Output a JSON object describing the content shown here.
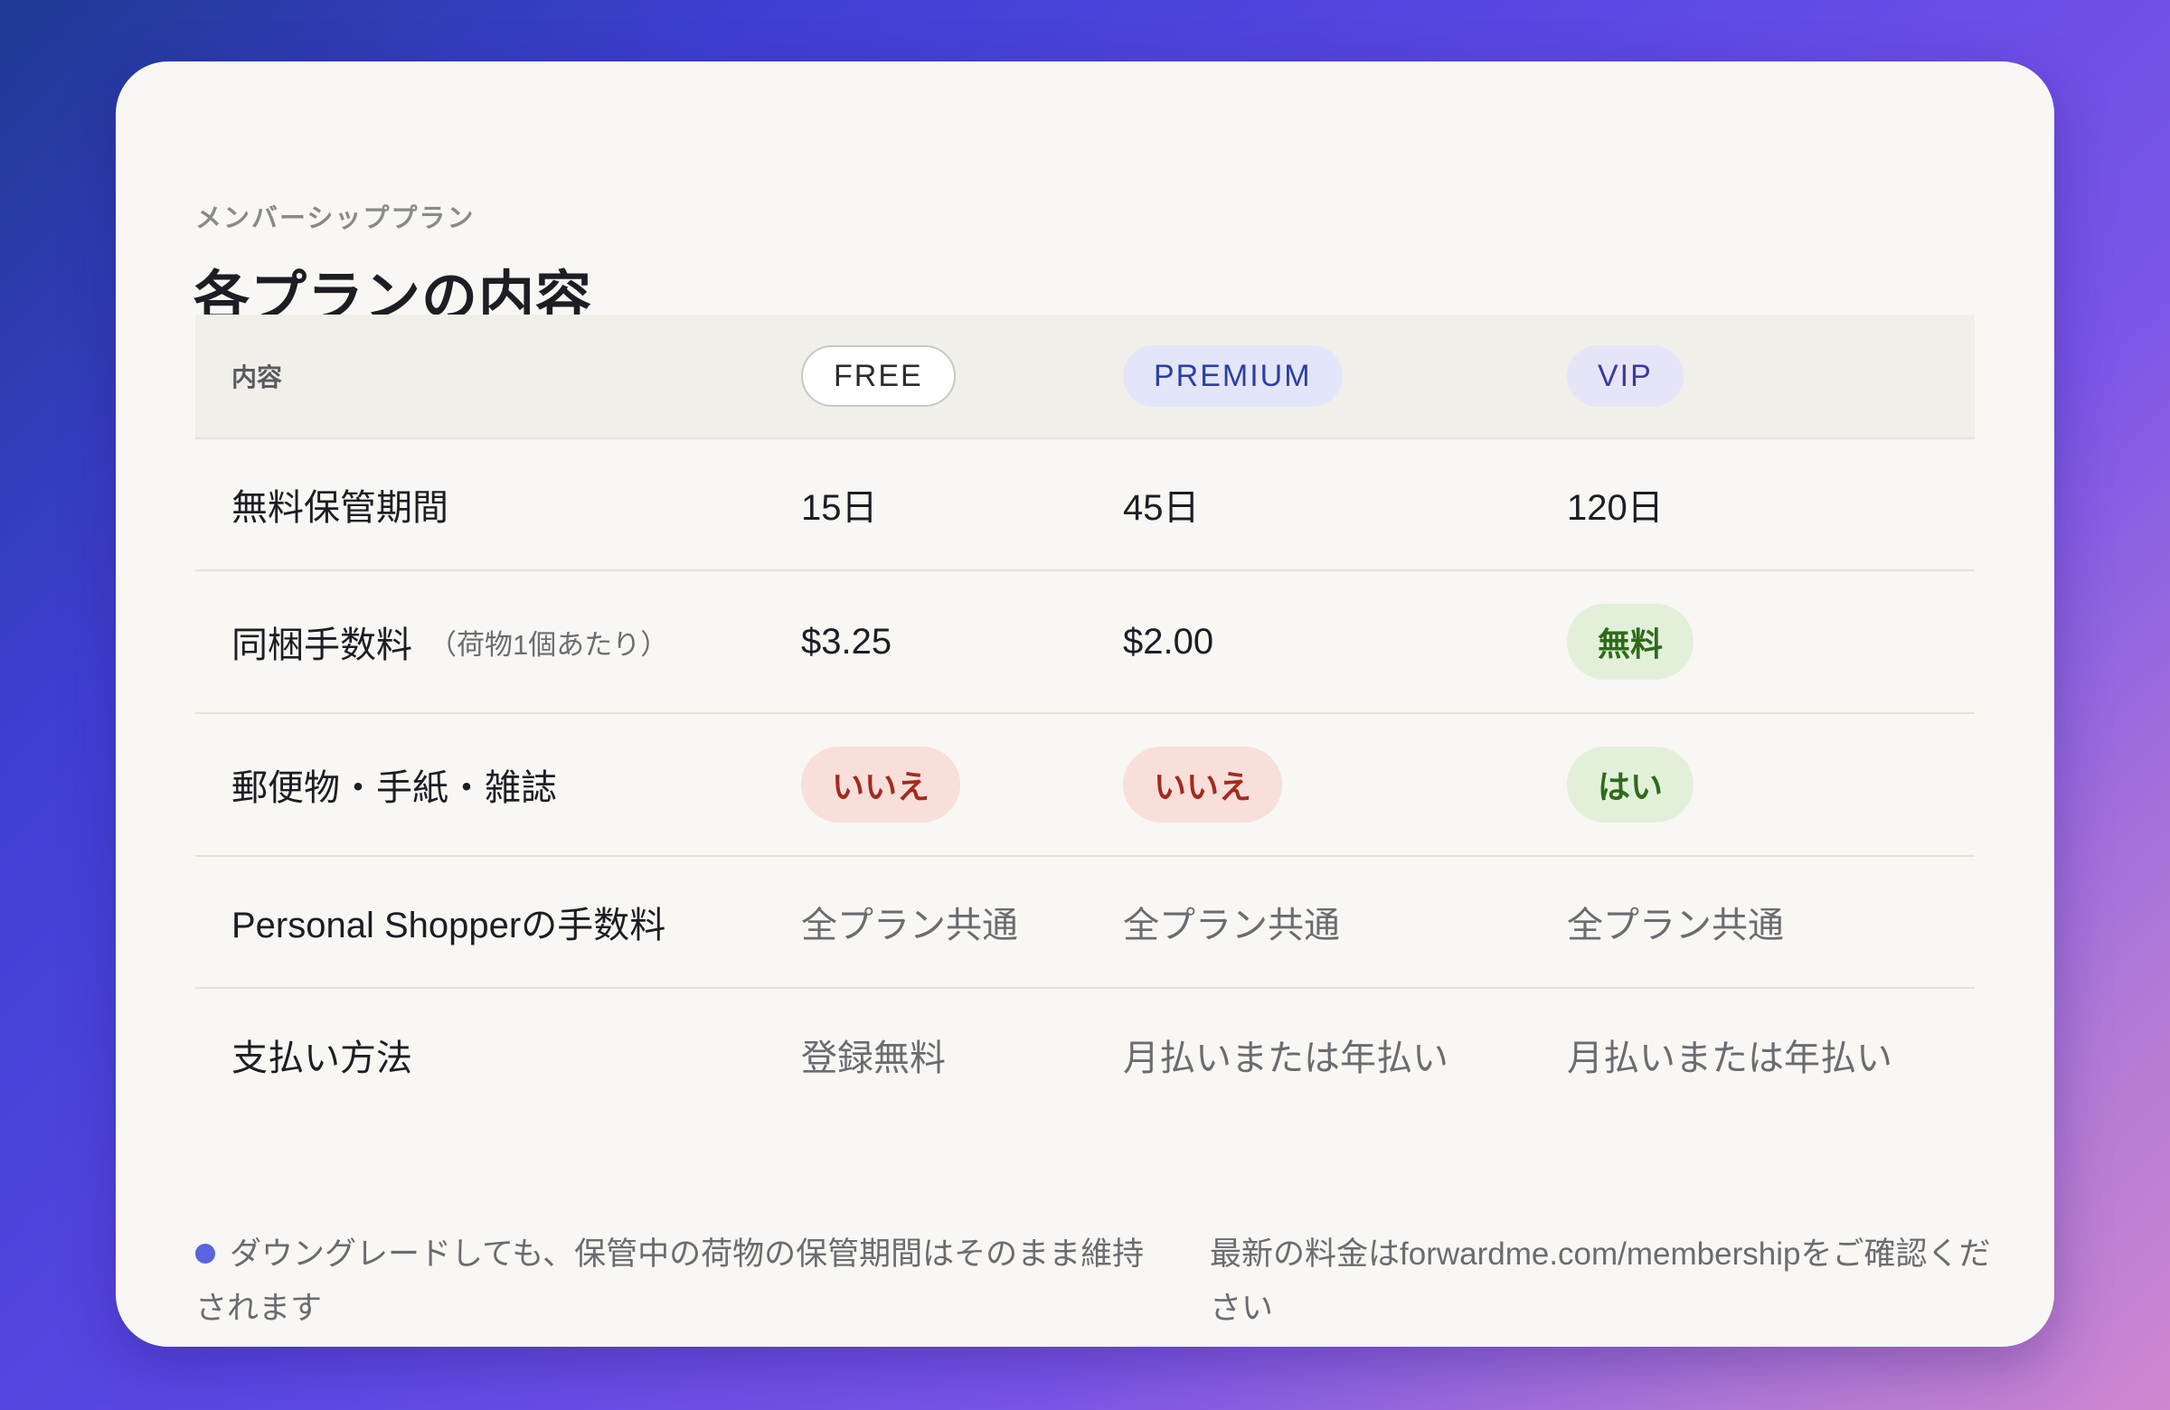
{
  "card": {
    "eyebrow": "メンバーシッププラン",
    "title": "各プランの内容"
  },
  "table": {
    "header": {
      "label": "内容",
      "plans": [
        "FREE",
        "PREMIUM",
        "VIP"
      ]
    },
    "rows": [
      {
        "label": "無料保管期間",
        "sublabel": "",
        "values": [
          "15日",
          "45日",
          "120日"
        ]
      },
      {
        "label": "同梱手数料",
        "sublabel": "（荷物1個あたり）",
        "values": [
          "$3.25",
          "$2.00",
          "無料"
        ]
      },
      {
        "label": "郵便物・手紙・雑誌",
        "sublabel": "",
        "values": [
          "いいえ",
          "いいえ",
          "はい"
        ]
      },
      {
        "label": "Personal Shopperの手数料",
        "sublabel": "",
        "values": [
          "全プラン共通",
          "全プラン共通",
          "全プラン共通"
        ]
      },
      {
        "label": "支払い方法",
        "sublabel": "",
        "values": [
          "登録無料",
          "月払いまたは年払い",
          "月払いまたは年払い"
        ]
      }
    ]
  },
  "footer": {
    "note_left": "ダウングレードしても、保管中の荷物の保管期間はそのまま維持されます",
    "note_right": "最新の料金はforwardme.com/membershipをご確認ください"
  },
  "colors": {
    "accent_dot": "#5a63e0",
    "yes_badge_bg": "#e2f0da",
    "yes_badge_text": "#2f6a1a",
    "no_badge_bg": "#f8dfda",
    "no_badge_text": "#a02c1e",
    "premium_pill_bg": "#e3e6fb",
    "vip_pill_bg": "#e6e5f7"
  }
}
